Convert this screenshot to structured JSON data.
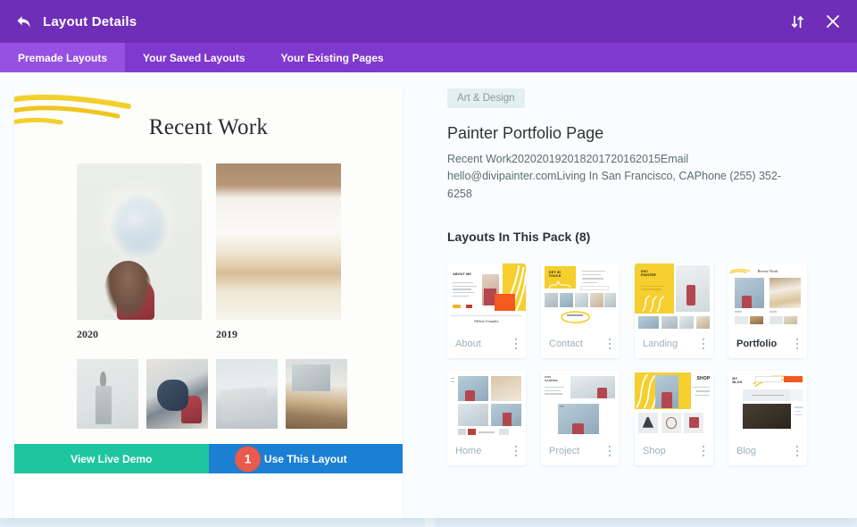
{
  "header": {
    "title": "Layout Details",
    "back_icon": "back-arrow-icon",
    "resize_icon": "sort-vertical-icon",
    "close_icon": "close-icon"
  },
  "tabs": [
    {
      "label": "Premade Layouts",
      "active": true
    },
    {
      "label": "Your Saved Layouts",
      "active": false
    },
    {
      "label": "Your Existing Pages",
      "active": false
    }
  ],
  "preview": {
    "heading": "Recent Work",
    "items": [
      {
        "year": "2020"
      },
      {
        "year": "2019"
      }
    ],
    "buttons": {
      "demo": "View Live Demo",
      "use": "Use This Layout"
    },
    "step_badge": "1"
  },
  "details": {
    "category": "Art & Design",
    "title": "Painter Portfolio Page",
    "description": "Recent Work202020192018201720162015Email hello@divipainter.comLiving In San Francisco, CAPhone (255) 352-6258",
    "pack_section_title": "Layouts In This Pack (8)"
  },
  "layouts": [
    {
      "name": "About",
      "active": false,
      "style": "about"
    },
    {
      "name": "Contact",
      "active": false,
      "style": "contact"
    },
    {
      "name": "Landing",
      "active": false,
      "style": "landing"
    },
    {
      "name": "Portfolio",
      "active": true,
      "style": "portfolio"
    },
    {
      "name": "Home",
      "active": false,
      "style": "home"
    },
    {
      "name": "Project",
      "active": false,
      "style": "project"
    },
    {
      "name": "Shop",
      "active": false,
      "style": "shop"
    },
    {
      "name": "Blog",
      "active": false,
      "style": "blog"
    }
  ],
  "thumb_text": {
    "about": "ABOUT ME",
    "about_sub": "Melvia Gonzales",
    "contact": "GET IN TOUCH",
    "landing": "DIVI PAINTER",
    "portfolio": "Recent Work",
    "shop": "SHOP",
    "blog": "MY BLOG"
  },
  "colors": {
    "header_purple": "#6f2eb8",
    "tabbar_purple": "#7f39cf",
    "tab_active_purple": "#9650e2",
    "demo_green": "#1ec6a0",
    "use_blue": "#1b7fd4",
    "badge_red": "#e8594e",
    "category_badge_bg": "#e4f0ef",
    "accent_yellow": "#f5cf2e",
    "page_bg": "#fafdff"
  }
}
